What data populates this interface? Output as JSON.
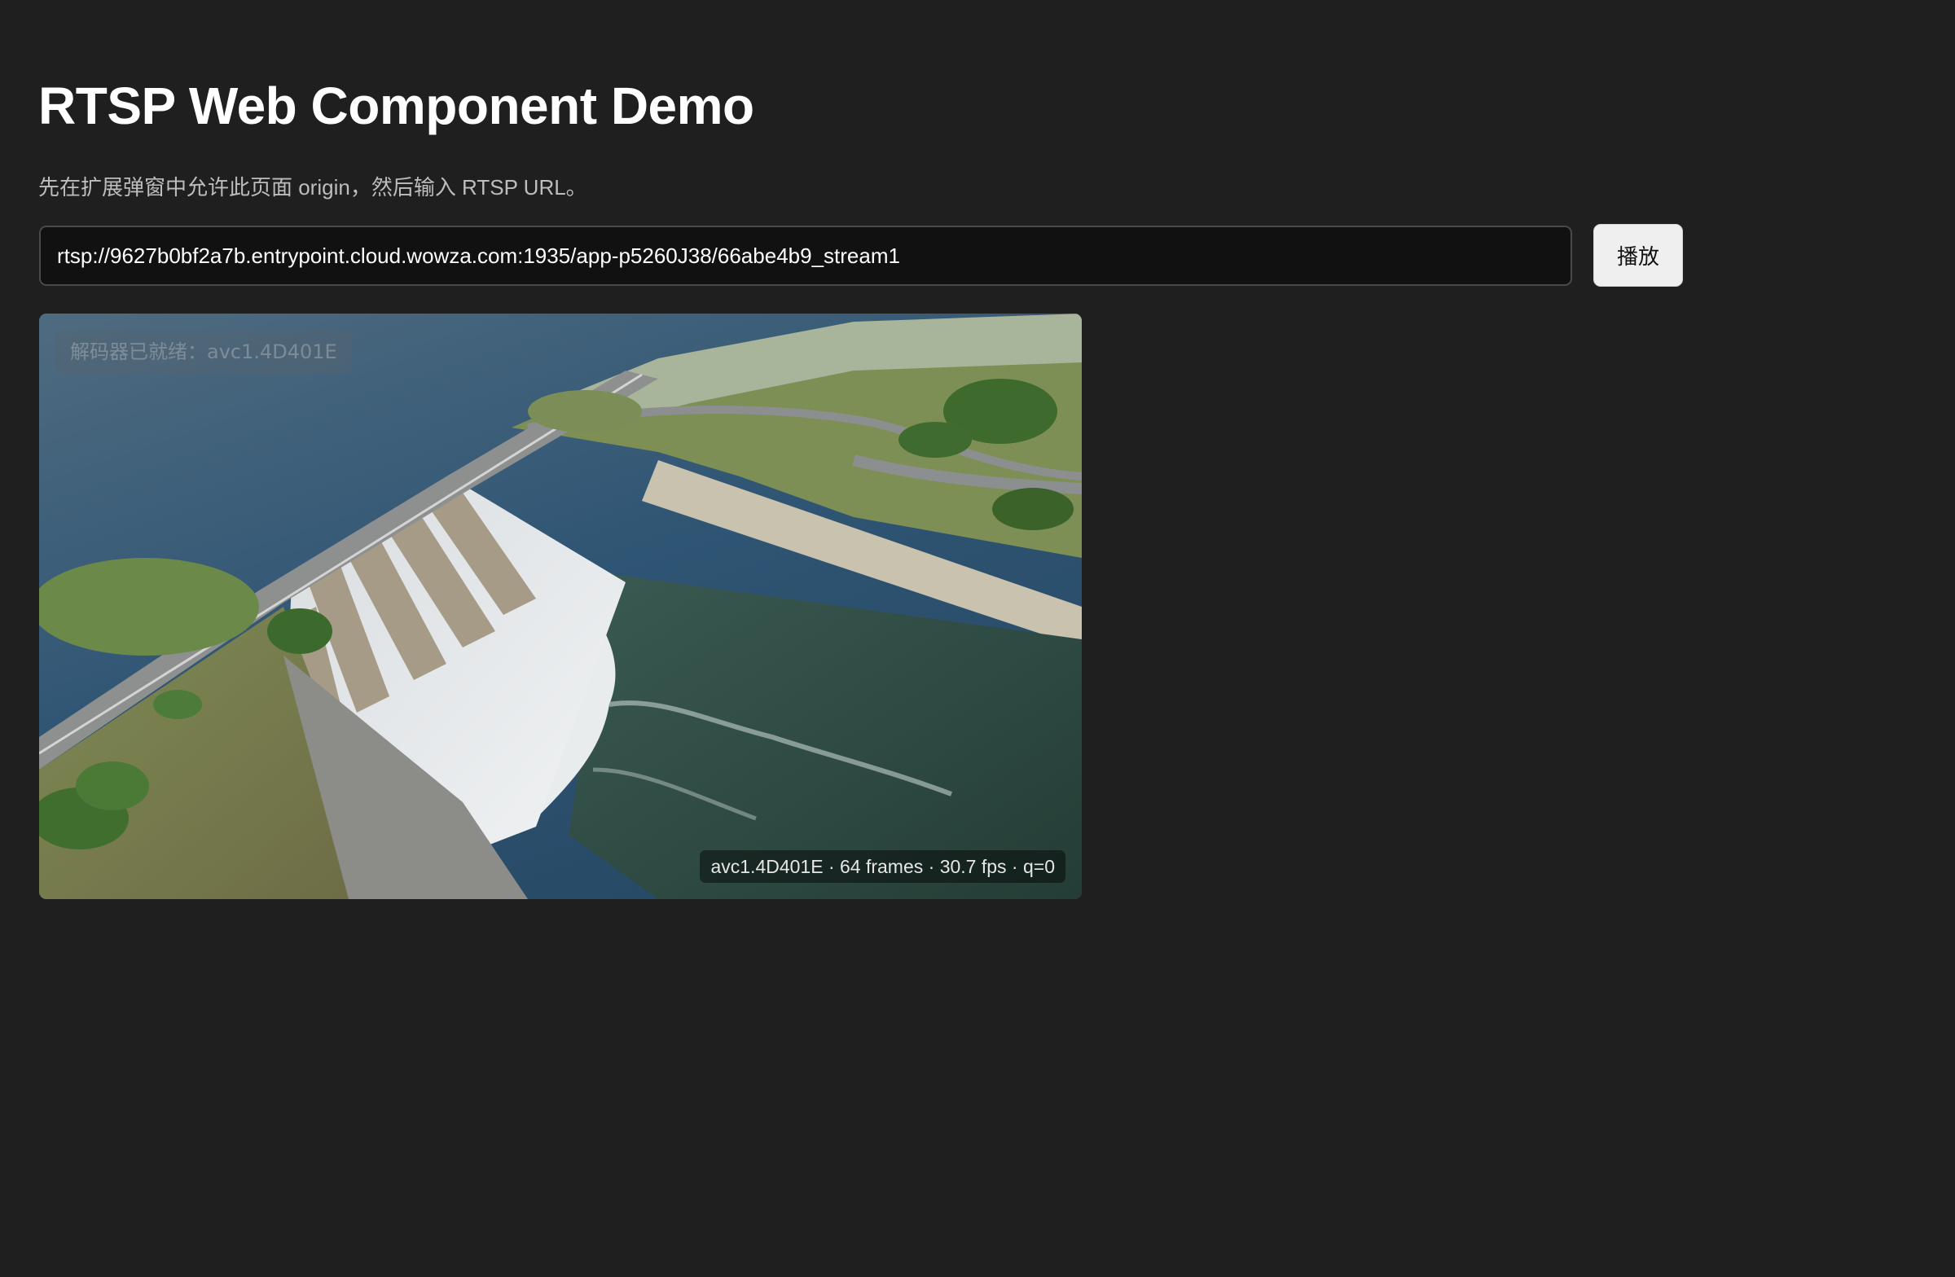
{
  "page": {
    "title": "RTSP Web Component Demo",
    "instruction": "先在扩展弹窗中允许此页面 origin，然后输入 RTSP URL。"
  },
  "stream_form": {
    "url_value": "rtsp://9627b0bf2a7b.entrypoint.cloud.wowza.com:1935/app-p5260J38/66abe4b9_stream1",
    "play_label": "播放"
  },
  "player": {
    "status_text": "解码器已就绪：avc1.4D401E",
    "stats_text": "avc1.4D401E · 64 frames · 30.7 fps · q=0",
    "video_content": "aerial-dam-spillway-scene"
  },
  "colors": {
    "background": "#1f1f1f",
    "input_background": "#111111",
    "button_background": "#efefef"
  }
}
